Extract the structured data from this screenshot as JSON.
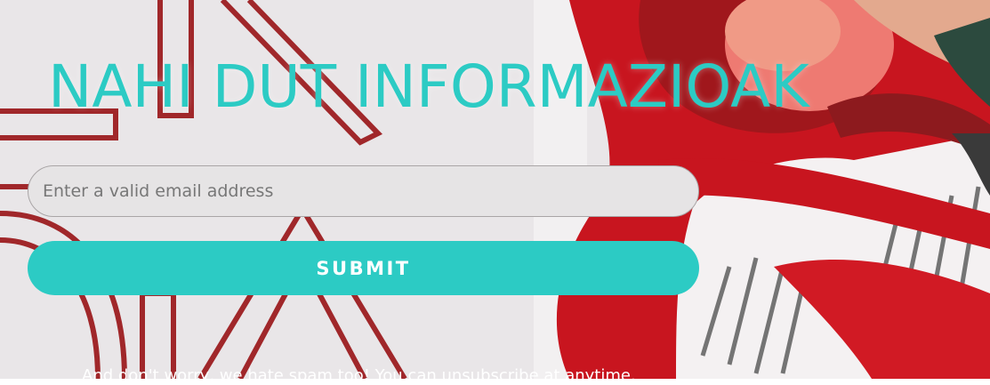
{
  "signup": {
    "headline": "NAHI DUT INFORMAZIOAK",
    "email_placeholder": "Enter a valid email address",
    "submit_label": "SUBMIT",
    "disclaimer": "And don't worry, we hate spam too! You can unsubscribe at anytime."
  },
  "colors": {
    "accent": "#2ccbc4",
    "background": "#e9e6e8",
    "artwork_red": "#c8151f",
    "artwork_dark_red": "#8d1a1e",
    "artwork_pink": "#ee7a72"
  },
  "artwork": {
    "description_icon": "background-illustration"
  }
}
